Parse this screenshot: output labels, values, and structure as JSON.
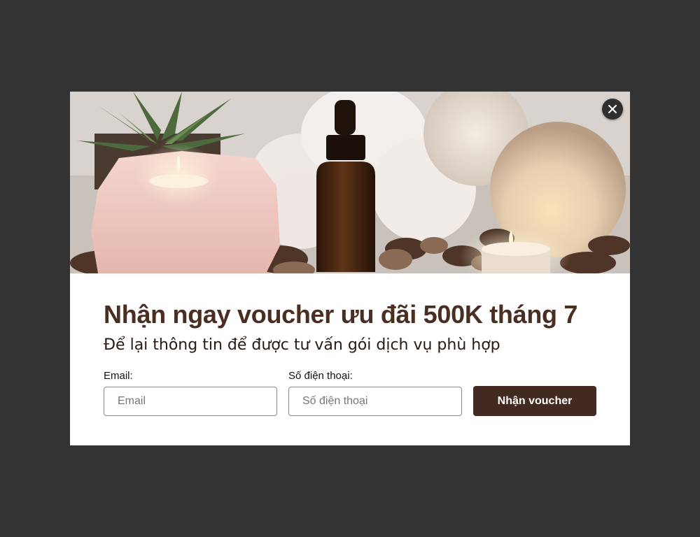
{
  "colors": {
    "backdrop": "#333333",
    "modal_bg": "#ffffff",
    "title": "#4a2e22",
    "button_bg": "#432a20",
    "button_text": "#ffffff",
    "close_bg": "#2f2f2f"
  },
  "hero": {
    "icon": "spa-candles-photo"
  },
  "close": {
    "icon": "close-icon"
  },
  "popup": {
    "title": "Nhận ngay voucher ưu đãi 500K tháng 7",
    "subtitle": "Để lại thông tin để được tư vấn gói dịch vụ phù hợp"
  },
  "form": {
    "email": {
      "label": "Email:",
      "placeholder": "Email",
      "value": ""
    },
    "phone": {
      "label": "Số điện thoại:",
      "placeholder": "Số điện thoại",
      "value": ""
    },
    "submit_label": "Nhận voucher"
  }
}
